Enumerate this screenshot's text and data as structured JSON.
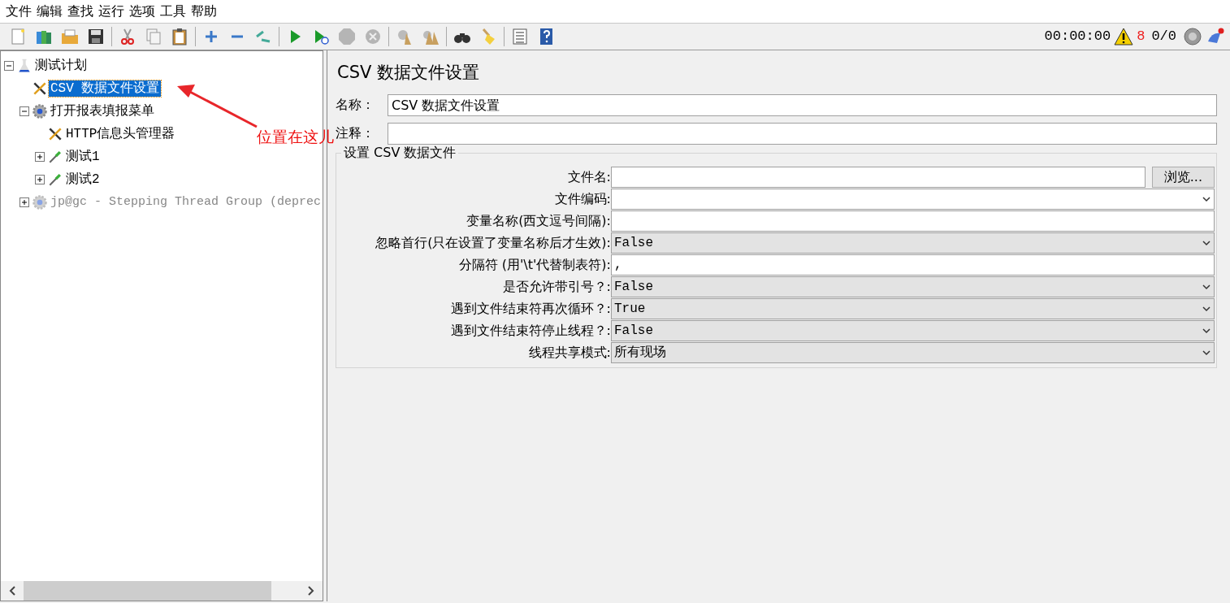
{
  "menu": [
    "文件",
    "编辑",
    "查找",
    "运行",
    "选项",
    "工具",
    "帮助"
  ],
  "status": {
    "time": "00:00:00",
    "warnings": "8",
    "threads": "0/0"
  },
  "tree": [
    {
      "label": "测试计划",
      "kind": "plan",
      "expanded": true,
      "selected": false,
      "disabled": false,
      "children": [
        {
          "label": "CSV 数据文件设置",
          "kind": "config",
          "selected": true,
          "disabled": false
        },
        {
          "label": "打开报表填报菜单",
          "kind": "thread-group",
          "expanded": true,
          "selected": false,
          "disabled": false,
          "children": [
            {
              "label": "HTTP信息头管理器",
              "kind": "config",
              "selected": false,
              "disabled": false
            },
            {
              "label": "测试1",
              "kind": "sampler",
              "expanded": false,
              "selected": false,
              "disabled": false
            },
            {
              "label": "测试2",
              "kind": "sampler",
              "expanded": false,
              "selected": false,
              "disabled": false
            }
          ]
        },
        {
          "label": "jp@gc - Stepping Thread Group (deprec",
          "kind": "thread-group",
          "expanded": false,
          "selected": false,
          "disabled": true
        }
      ]
    }
  ],
  "annotation": "位置在这儿",
  "panel": {
    "title": "CSV 数据文件设置",
    "name_label": "名称：",
    "name_value": "CSV 数据文件设置",
    "comment_label": "注释：",
    "group_title": "设置 CSV 数据文件",
    "browse_button": "浏览...",
    "fields": [
      {
        "label": "文件名:",
        "kind": "text"
      },
      {
        "label": "文件编码:",
        "kind": "combo"
      },
      {
        "label": "变量名称(西文逗号间隔):",
        "kind": "text"
      },
      {
        "label": "忽略首行(只在设置了变量名称后才生效):",
        "kind": "select",
        "value": "False"
      },
      {
        "label": "分隔符 (用'\\t'代替制表符):",
        "kind": "text",
        "value": ","
      },
      {
        "label": "是否允许带引号？:",
        "kind": "select",
        "value": "False"
      },
      {
        "label": "遇到文件结束符再次循环？:",
        "kind": "select",
        "value": "True"
      },
      {
        "label": "遇到文件结束符停止线程？:",
        "kind": "select",
        "value": "False"
      },
      {
        "label": "线程共享模式:",
        "kind": "select",
        "value": "所有现场"
      }
    ]
  }
}
